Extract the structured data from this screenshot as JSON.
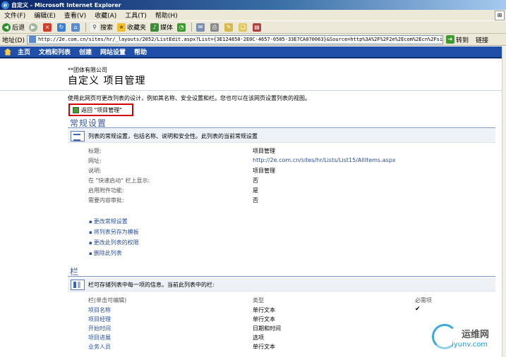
{
  "window": {
    "title": "自定义 - Microsoft Internet Explorer",
    "logo_text": "⊞"
  },
  "menu": [
    "文件(F)",
    "编辑(E)",
    "查看(V)",
    "收藏(A)",
    "工具(T)",
    "帮助(H)"
  ],
  "toolbar": {
    "back": "后退",
    "search": "搜索",
    "favorites": "收藏夹",
    "media": "媒体"
  },
  "address": {
    "label": "地址(D)",
    "url": "http://2e.com.cn/sites/hr/_layouts/2052/ListEdit.aspx?List={3E124850-2E0C-4657-0505-33E7CA070063}&Source=http%3A%2F%2F2e%2Ecom%2Ecn%2Fsi",
    "go": "转到",
    "links": "链接"
  },
  "sp_nav": [
    "主页",
    "文档和列表",
    "创建",
    "网站设置",
    "帮助"
  ],
  "site": {
    "name": "**团体有限公司",
    "title": "自定义 项目管理"
  },
  "description": "使用此网页可更改列表的设计，例如其名称、安全设置和栏。您也可以在该网页设置列表的视图。",
  "back_link": "返回 \"项目管理\"",
  "general": {
    "title": "常规设置",
    "band": "列表的常规设置，包括名称、说明和安全性。此列表的当前常规设置",
    "rows": [
      {
        "label": "标题:",
        "value": "项目管理",
        "link": false
      },
      {
        "label": "网址:",
        "value": "http://2e.com.cn/sites/hr/Lists/List15/AllItems.aspx",
        "link": true
      },
      {
        "label": "说明:",
        "value": "项目管理",
        "link": false
      },
      {
        "label": "在 \"快速启动\" 栏上显示:",
        "value": "否",
        "link": false
      },
      {
        "label": "启用附件功能:",
        "value": "是",
        "link": false
      },
      {
        "label": "需要内容审批:",
        "value": "否",
        "link": false
      }
    ],
    "links": [
      "更改常规设置",
      "将列表另存为模板",
      "更改此列表的权限",
      "删除此列表"
    ]
  },
  "columns": {
    "title": "栏",
    "band": "栏可存储列表中每一项的信息。当前此列表中的栏:",
    "headers": {
      "name": "栏(单击可编辑)",
      "type": "类型",
      "required": "必需项"
    },
    "rows": [
      {
        "name": "项目名称",
        "type": "单行文本",
        "required": true
      },
      {
        "name": "项目经理",
        "type": "单行文本",
        "required": false
      },
      {
        "name": "开始时间",
        "type": "日期和时间",
        "required": false
      },
      {
        "name": "项目进展",
        "type": "选项",
        "required": false
      },
      {
        "name": "业务人员",
        "type": "单行文本",
        "required": false
      }
    ]
  },
  "watermark": {
    "cn": "运维网",
    "url": "iyunv.com"
  }
}
